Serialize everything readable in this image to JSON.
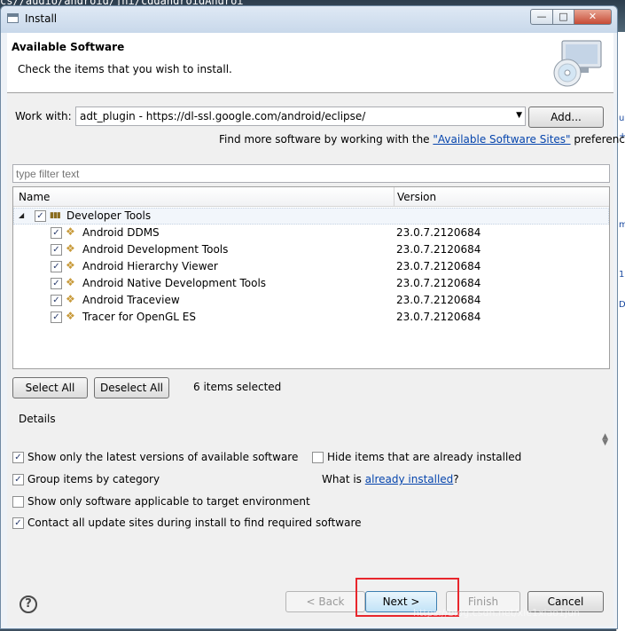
{
  "background": {
    "path_text": "cs//audio/android/jni/cddandroidAndroi"
  },
  "window": {
    "title": "Install"
  },
  "header": {
    "title": "Available Software",
    "subtitle": "Check the items that you wish to install."
  },
  "work_with": {
    "label": "Work with:",
    "value": "adt_plugin - https://dl-ssl.google.com/android/eclipse/",
    "add_button": "Add...",
    "more_prefix": "Find more software by working with the ",
    "more_link": "\"Available Software Sites\"",
    "more_suffix": " preferences."
  },
  "filter": {
    "placeholder": "type filter text"
  },
  "tree": {
    "columns": {
      "name": "Name",
      "version": "Version"
    },
    "category": {
      "label": "Developer Tools",
      "checked": true
    },
    "items": [
      {
        "name": "Android DDMS",
        "version": "23.0.7.2120684",
        "checked": true
      },
      {
        "name": "Android Development Tools",
        "version": "23.0.7.2120684",
        "checked": true
      },
      {
        "name": "Android Hierarchy Viewer",
        "version": "23.0.7.2120684",
        "checked": true
      },
      {
        "name": "Android Native Development Tools",
        "version": "23.0.7.2120684",
        "checked": true
      },
      {
        "name": "Android Traceview",
        "version": "23.0.7.2120684",
        "checked": true
      },
      {
        "name": "Tracer for OpenGL ES",
        "version": "23.0.7.2120684",
        "checked": true
      }
    ]
  },
  "selection": {
    "select_all": "Select All",
    "deselect_all": "Deselect All",
    "count_text": "6 items selected"
  },
  "details": {
    "label": "Details"
  },
  "options": {
    "latest_only": "Show only the latest versions of available software",
    "latest_only_checked": true,
    "hide_installed": "Hide items that are already installed",
    "hide_installed_checked": false,
    "group_by_category": "Group items by category",
    "group_by_category_checked": true,
    "what_is_prefix": "What is ",
    "already_installed_link": "already installed",
    "what_is_suffix": "?",
    "target_env": "Show only software applicable to target environment",
    "target_env_checked": false,
    "contact_sites": "Contact all update sites during install to find required software",
    "contact_sites_checked": true
  },
  "buttons": {
    "back": "< Back",
    "next": "Next >",
    "finish": "Finish",
    "cancel": "Cancel"
  },
  "watermark": "https://blog.csdn.net/xie1xiao1jun",
  "colors": {
    "link": "#0645ad",
    "highlight_box": "#e8262c"
  }
}
